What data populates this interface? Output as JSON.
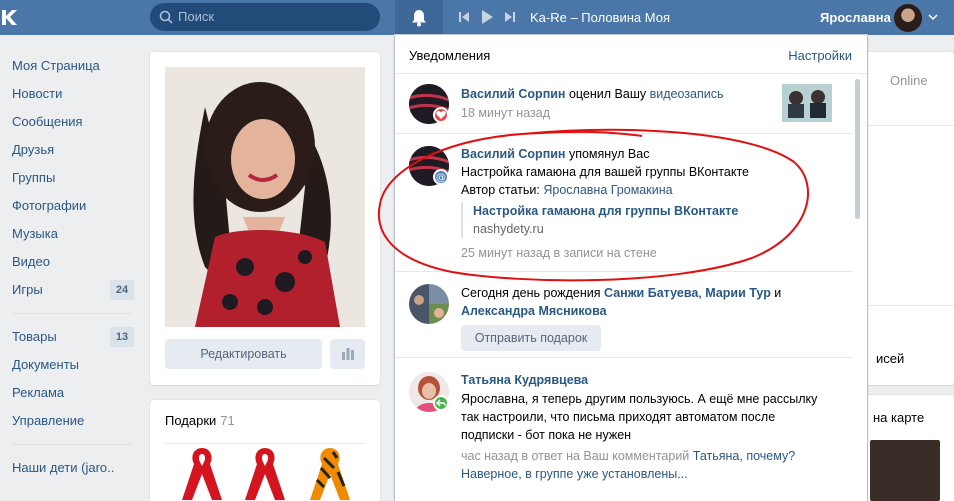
{
  "header": {
    "search_placeholder": "Поиск",
    "track": "Ka-Re – Половина Моя",
    "user_name": "Ярославна"
  },
  "nav": {
    "items": [
      {
        "label": "Моя Страница"
      },
      {
        "label": "Новости"
      },
      {
        "label": "Сообщения"
      },
      {
        "label": "Друзья"
      },
      {
        "label": "Группы"
      },
      {
        "label": "Фотографии"
      },
      {
        "label": "Музыка"
      },
      {
        "label": "Видео"
      },
      {
        "label": "Игры",
        "count": "24"
      }
    ],
    "items2": [
      {
        "label": "Товары",
        "count": "13"
      },
      {
        "label": "Документы"
      },
      {
        "label": "Реклама"
      },
      {
        "label": "Управление"
      }
    ],
    "items3": [
      {
        "label": "Наши дети (jaro.."
      }
    ]
  },
  "profile": {
    "edit_label": "Редактировать",
    "gifts_title": "Подарки",
    "gifts_count": "71"
  },
  "right": {
    "online": "Online",
    "text1": "исей",
    "text2": "на карте"
  },
  "popup": {
    "title": "Уведомления",
    "settings": "Настройки",
    "n1": {
      "author": "Василий Сорпин",
      "action": " оценил Вашу ",
      "link": "видеозапись",
      "time": "18 минут назад"
    },
    "n2": {
      "author": "Василий Сорпин",
      "action": " упомянул Вас",
      "line1": "Настройка гамаюна для вашей группы ВКонтакте",
      "line2_prefix": "Автор статьи: ",
      "line2_link": "Ярославна Громакина",
      "quote_title": "Настройка гамаюна для группы ВКонтакте",
      "quote_domain": "nashydety.ru",
      "time": "25 минут назад в записи на стене"
    },
    "n3": {
      "prefix": "Сегодня день рождения ",
      "name1": "Санжи Батуева",
      "sep1": ", ",
      "name2": "Марии Тур",
      "sep2": " и",
      "name3": "Александра Мясникова",
      "button": "Отправить подарок"
    },
    "n4": {
      "author": "Татьяна Кудрявцева",
      "line1": "Ярославна, я теперь другим пользуюсь. А ещё мне рассылку",
      "line2": "так настроили, что письма приходят автоматом после",
      "line3": "подписки - бот пока не нужен",
      "meta_prefix": "час назад в ответ на Ваш комментарий ",
      "meta_link": "Татьяна, почему?",
      "meta_line2": "Наверное, в группе уже установлены..."
    }
  },
  "colors": {
    "header_bg": "#4a76a8",
    "link": "#2a5885",
    "page_bg": "#edeef0",
    "annotation": "#e01010"
  }
}
